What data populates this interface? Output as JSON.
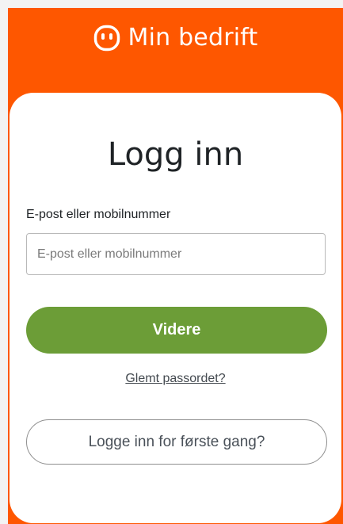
{
  "brand": {
    "name": "Min bedrift",
    "icon": "smiley-logo-icon"
  },
  "login": {
    "title": "Logg inn",
    "field_label": "E-post eller mobilnummer",
    "field_placeholder": "E-post eller mobilnummer",
    "field_value": "",
    "submit_label": "Videre",
    "forgot_link": "Glemt passordet?",
    "first_time_label": "Logge inn for første gang?"
  },
  "colors": {
    "brand_orange": "#fe5700",
    "primary_green": "#6c9d37",
    "card_bg": "#ffffff",
    "text_dark": "#1f2326"
  }
}
